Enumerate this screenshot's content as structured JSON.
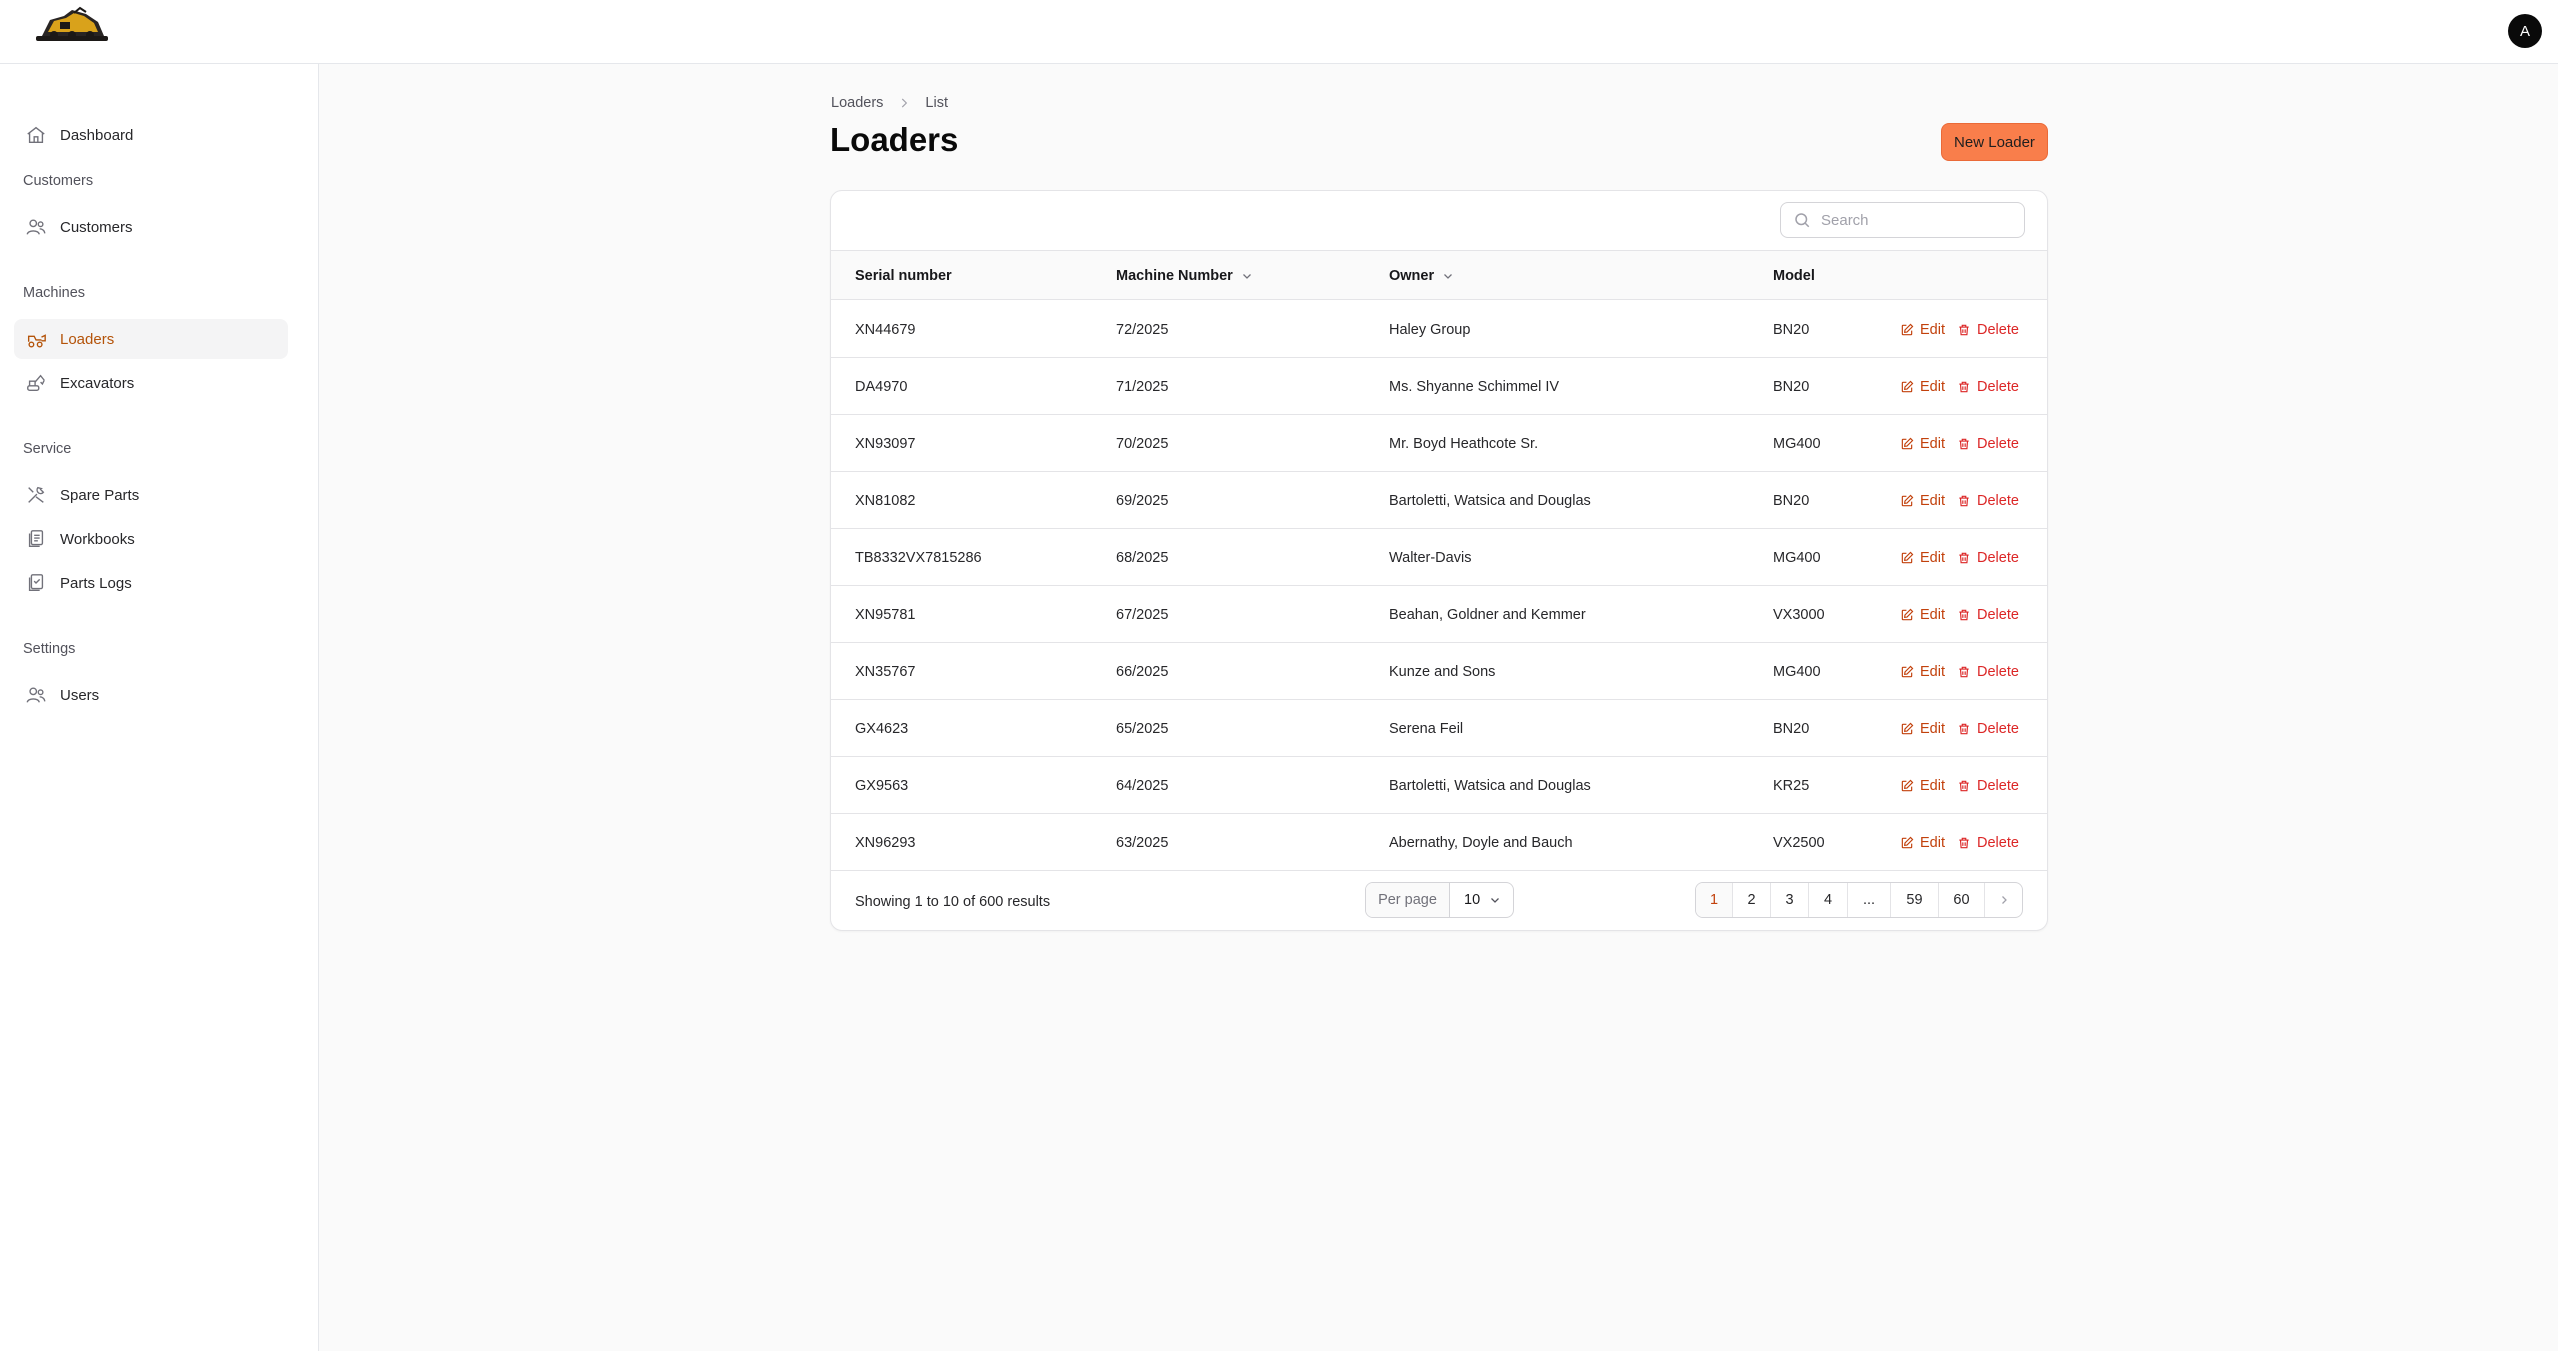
{
  "header": {
    "avatar_initial": "A",
    "logo": "loader-machine-logo"
  },
  "sidebar": {
    "dashboard": "Dashboard",
    "groups": {
      "customers": "Customers",
      "machines": "Machines",
      "service": "Service",
      "settings": "Settings"
    },
    "items": {
      "customers": "Customers",
      "loaders": "Loaders",
      "excavators": "Excavators",
      "spare_parts": "Spare Parts",
      "workbooks": "Workbooks",
      "parts_logs": "Parts Logs",
      "users": "Users"
    },
    "active": "loaders",
    "accent_color": "#b45309"
  },
  "breadcrumb": {
    "root": "Loaders",
    "current": "List"
  },
  "page": {
    "title": "Loaders",
    "new_button": "New Loader",
    "button_color": "#f97e4b"
  },
  "search": {
    "placeholder": "Search"
  },
  "table": {
    "columns": {
      "serial": "Serial number",
      "machine": "Machine Number",
      "owner": "Owner",
      "model": "Model"
    },
    "actions": {
      "edit": "Edit",
      "delete": "Delete"
    },
    "rows": [
      {
        "serial": "XN44679",
        "machine": "72/2025",
        "owner": "Haley Group",
        "model": "BN20"
      },
      {
        "serial": "DA4970",
        "machine": "71/2025",
        "owner": "Ms. Shyanne Schimmel IV",
        "model": "BN20"
      },
      {
        "serial": "XN93097",
        "machine": "70/2025",
        "owner": "Mr. Boyd Heathcote Sr.",
        "model": "MG400"
      },
      {
        "serial": "XN81082",
        "machine": "69/2025",
        "owner": "Bartoletti, Watsica and Douglas",
        "model": "BN20"
      },
      {
        "serial": "TB8332VX7815286",
        "machine": "68/2025",
        "owner": "Walter-Davis",
        "model": "MG400"
      },
      {
        "serial": "XN95781",
        "machine": "67/2025",
        "owner": "Beahan, Goldner and Kemmer",
        "model": "VX3000"
      },
      {
        "serial": "XN35767",
        "machine": "66/2025",
        "owner": "Kunze and Sons",
        "model": "MG400"
      },
      {
        "serial": "GX4623",
        "machine": "65/2025",
        "owner": "Serena Feil",
        "model": "BN20"
      },
      {
        "serial": "GX9563",
        "machine": "64/2025",
        "owner": "Bartoletti, Watsica and Douglas",
        "model": "KR25"
      },
      {
        "serial": "XN96293",
        "machine": "63/2025",
        "owner": "Abernathy, Doyle and Bauch",
        "model": "VX2500"
      }
    ]
  },
  "footer": {
    "showing": "Showing 1 to 10 of 600 results",
    "per_page_label": "Per page",
    "per_page_value": "10",
    "pages": [
      "1",
      "2",
      "3",
      "4",
      "...",
      "59",
      "60"
    ],
    "current_page": "1"
  }
}
